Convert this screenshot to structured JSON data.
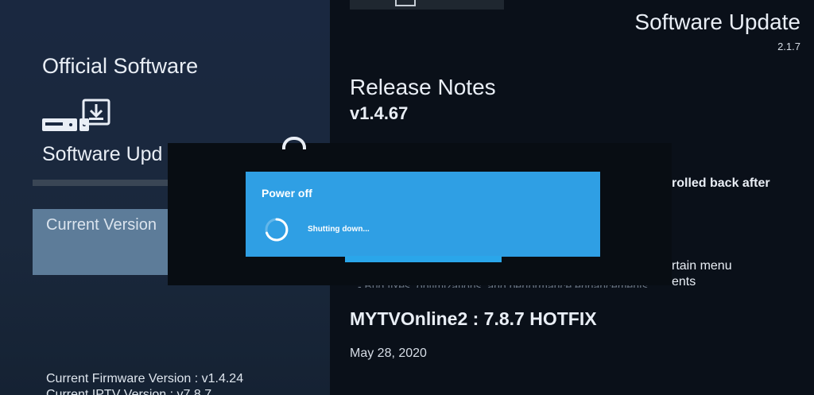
{
  "left_panel": {
    "title": "Official Software",
    "icon": "download-device-icon",
    "subtitle": "Software Upd",
    "current_version_label": "Current Version",
    "firmware_version": "Current Firmware Version : v1.4.24",
    "iptv_version": "Current IPTV Version : v7.8.7"
  },
  "header": {
    "title": "Software Update",
    "version": "2.1.7"
  },
  "release": {
    "title": "Release Notes",
    "version": "v1.4.67",
    "note_fragment_1": "rolled back after",
    "note_fragment_2": "rtain menu",
    "note_fragment_3": "ents",
    "faint_line": "- Bug fixes, optimizations, and performance enhancements"
  },
  "hotfix": {
    "title": "MYTVOnline2 : 7.8.7 HOTFIX",
    "date": "May 28, 2020"
  },
  "dialog": {
    "title": "Power off",
    "message": "Shutting down...",
    "accent": "#2f9fe4"
  }
}
